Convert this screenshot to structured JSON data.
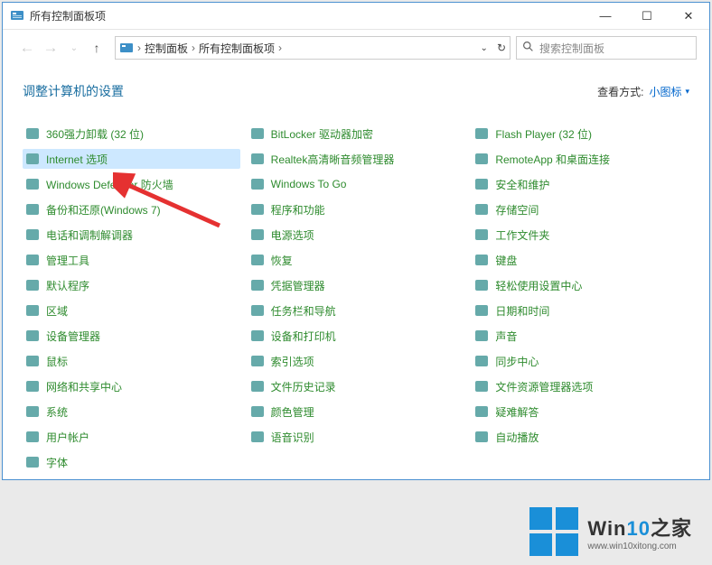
{
  "titlebar": {
    "title": "所有控制面板项"
  },
  "win_controls": {
    "minimize": "—",
    "maximize": "☐",
    "close": "✕"
  },
  "breadcrumbs": {
    "root": "控制面板",
    "current": "所有控制面板项"
  },
  "addressbar_refresh": "↻",
  "search": {
    "placeholder": "搜索控制面板"
  },
  "header": {
    "text": "调整计算机的设置"
  },
  "view_mode": {
    "label": "查看方式:",
    "value": "小图标"
  },
  "columns": [
    [
      {
        "name": "360-uninstall",
        "label": "360强力卸载 (32 位)"
      },
      {
        "name": "internet-options",
        "label": "Internet 选项",
        "selected": true
      },
      {
        "name": "windows-defender-firewall",
        "label": "Windows Defender 防火墙"
      },
      {
        "name": "backup-restore",
        "label": "备份和还原(Windows 7)"
      },
      {
        "name": "phone-modem",
        "label": "电话和调制解调器"
      },
      {
        "name": "admin-tools",
        "label": "管理工具"
      },
      {
        "name": "default-programs",
        "label": "默认程序"
      },
      {
        "name": "region",
        "label": "区域"
      },
      {
        "name": "device-manager",
        "label": "设备管理器"
      },
      {
        "name": "mouse",
        "label": "鼠标"
      },
      {
        "name": "network-sharing",
        "label": "网络和共享中心"
      },
      {
        "name": "system",
        "label": "系统"
      },
      {
        "name": "user-accounts",
        "label": "用户帐户"
      },
      {
        "name": "fonts",
        "label": "字体"
      }
    ],
    [
      {
        "name": "bitlocker",
        "label": "BitLocker 驱动器加密"
      },
      {
        "name": "realtek-audio",
        "label": "Realtek高清晰音频管理器"
      },
      {
        "name": "windows-to-go",
        "label": "Windows To Go"
      },
      {
        "name": "programs-features",
        "label": "程序和功能"
      },
      {
        "name": "power-options",
        "label": "电源选项"
      },
      {
        "name": "recovery",
        "label": "恢复"
      },
      {
        "name": "credential-manager",
        "label": "凭据管理器"
      },
      {
        "name": "taskbar-navigation",
        "label": "任务栏和导航"
      },
      {
        "name": "devices-printers",
        "label": "设备和打印机"
      },
      {
        "name": "indexing-options",
        "label": "索引选项"
      },
      {
        "name": "file-history",
        "label": "文件历史记录"
      },
      {
        "name": "color-management",
        "label": "颜色管理"
      },
      {
        "name": "speech-recognition",
        "label": "语音识别"
      }
    ],
    [
      {
        "name": "flash-player",
        "label": "Flash Player (32 位)"
      },
      {
        "name": "remoteapp",
        "label": "RemoteApp 和桌面连接"
      },
      {
        "name": "security-maintenance",
        "label": "安全和维护"
      },
      {
        "name": "storage-spaces",
        "label": "存储空间"
      },
      {
        "name": "work-folders",
        "label": "工作文件夹"
      },
      {
        "name": "keyboard",
        "label": "键盘"
      },
      {
        "name": "ease-of-access",
        "label": "轻松使用设置中心"
      },
      {
        "name": "date-time",
        "label": "日期和时间"
      },
      {
        "name": "sound",
        "label": "声音"
      },
      {
        "name": "sync-center",
        "label": "同步中心"
      },
      {
        "name": "explorer-options",
        "label": "文件资源管理器选项"
      },
      {
        "name": "troubleshooting",
        "label": "疑难解答"
      },
      {
        "name": "autoplay",
        "label": "自动播放"
      }
    ]
  ],
  "watermark": {
    "title_plain": "Win",
    "title_accent": "10",
    "title_suffix": "之家",
    "url": "www.win10xitong.com"
  },
  "icon_colors": {
    "default": "#5aa0c8",
    "green": "#4caf50",
    "orange": "#e69436",
    "red": "#d04a4a",
    "yellow": "#e6c84a",
    "gray": "#888"
  }
}
